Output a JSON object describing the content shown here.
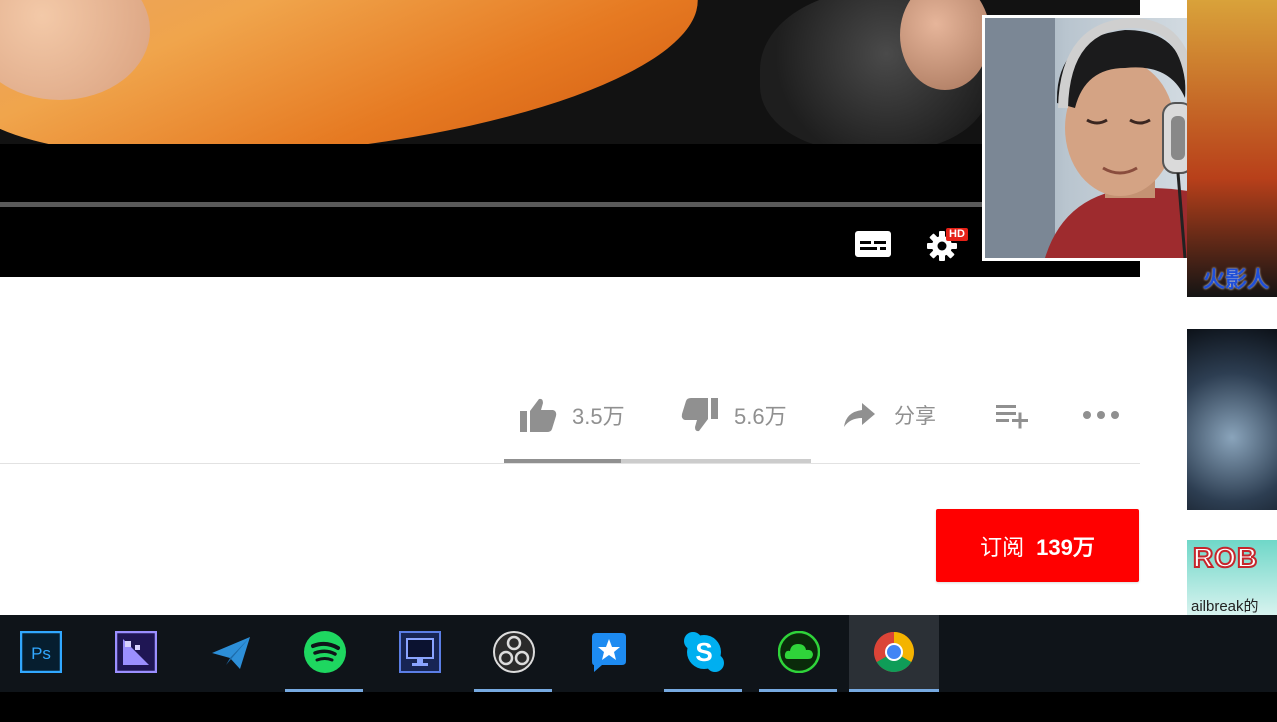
{
  "player": {
    "progress_fraction": 0.0,
    "controls": {
      "subtitles": "subtitles-icon",
      "settings": "settings-gear-icon",
      "settings_badge": "HD"
    }
  },
  "sidebar": {
    "thumbnails": [
      {
        "overlay_text": "火影人"
      },
      {
        "overlay_text": ""
      },
      {
        "overlay_text": "ROB",
        "sub_text": "ailbreak的"
      }
    ]
  },
  "actions": {
    "like_count": "3.5万",
    "dislike_count": "5.6万",
    "share_label": "分享",
    "sentiment_like_fraction": 0.38
  },
  "subscribe": {
    "label": "订阅",
    "count": "139万",
    "color": "#ff0000"
  },
  "taskbar": {
    "items": [
      {
        "name": "photoshop",
        "icon": "photoshop-icon",
        "running": false,
        "active": false
      },
      {
        "name": "media-encoder",
        "icon": "media-encoder-icon",
        "running": false,
        "active": false
      },
      {
        "name": "paper-plane-app",
        "icon": "paper-plane-icon",
        "running": false,
        "active": false
      },
      {
        "name": "spotify",
        "icon": "spotify-icon",
        "running": true,
        "active": false
      },
      {
        "name": "monitor-app",
        "icon": "monitor-icon",
        "running": false,
        "active": false
      },
      {
        "name": "obs",
        "icon": "obs-icon",
        "running": true,
        "active": false
      },
      {
        "name": "star-chat-app",
        "icon": "star-chat-icon",
        "running": false,
        "active": false
      },
      {
        "name": "skype",
        "icon": "skype-icon",
        "running": true,
        "active": false
      },
      {
        "name": "cloud-app",
        "icon": "cloud-icon",
        "running": true,
        "active": false
      },
      {
        "name": "chrome",
        "icon": "chrome-icon",
        "running": true,
        "active": true
      }
    ]
  }
}
